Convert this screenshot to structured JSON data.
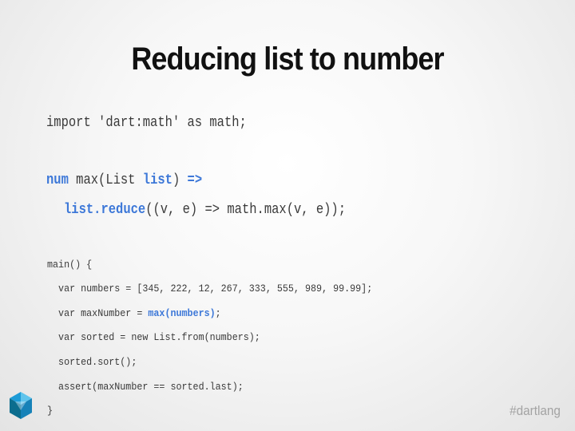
{
  "slide": {
    "title": "Reducing list to number",
    "hashtag": "#dartlang"
  },
  "code": {
    "line1": "import 'dart:math' as math;",
    "line2": {
      "kw_num": "num",
      "t1": " max(List ",
      "kw_list": "list",
      "t2": ") ",
      "kw_arrow": "=>"
    },
    "line3": {
      "kw_reduce": "list.reduce",
      "t1": "((v, e) => math.max(v, e));"
    },
    "main": {
      "line1": "main() {",
      "line2": "  var numbers = [345, 222, 12, 267, 333, 555, 989, 99.99];",
      "line3": {
        "t1": "  var maxNumber = ",
        "kw_max": "max(numbers)",
        "t2": ";"
      },
      "line4": "  var sorted = new List.from(numbers);",
      "line5": "  sorted.sort();",
      "line6": "  assert(maxNumber == sorted.last);",
      "line7": "}"
    }
  },
  "colors": {
    "keyword": "#3d78d8",
    "logo_dark": "#0b6d8e",
    "logo_mid": "#1d9bd6",
    "logo_light": "#5fc4ec"
  },
  "icons": {
    "logo": "dart-logo-icon"
  }
}
